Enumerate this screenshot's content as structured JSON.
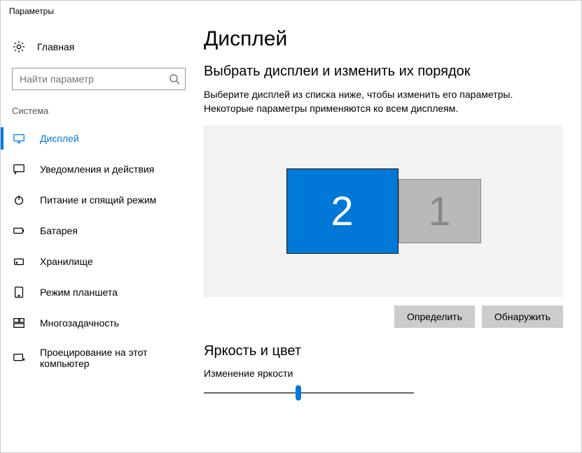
{
  "window": {
    "title": "Параметры"
  },
  "sidebar": {
    "home_label": "Главная",
    "search_placeholder": "Найти параметр",
    "section_label": "Система",
    "items": [
      {
        "id": "display",
        "label": "Дисплей",
        "active": true
      },
      {
        "id": "notifications",
        "label": "Уведомления и действия",
        "active": false
      },
      {
        "id": "power",
        "label": "Питание и спящий режим",
        "active": false
      },
      {
        "id": "battery",
        "label": "Батарея",
        "active": false
      },
      {
        "id": "storage",
        "label": "Хранилище",
        "active": false
      },
      {
        "id": "tablet",
        "label": "Режим планшета",
        "active": false
      },
      {
        "id": "multitask",
        "label": "Многозадачность",
        "active": false
      },
      {
        "id": "projecting",
        "label": "Проецирование на этот компьютер",
        "active": false
      }
    ]
  },
  "main": {
    "title": "Дисплей",
    "arrange": {
      "heading": "Выбрать дисплеи и изменить их порядок",
      "description": "Выберите дисплей из списка ниже, чтобы изменить его параметры. Некоторые параметры применяются ко всем дисплеям.",
      "monitors": [
        {
          "number": "2",
          "selected": true
        },
        {
          "number": "1",
          "selected": false
        }
      ],
      "identify_label": "Определить",
      "detect_label": "Обнаружить"
    },
    "brightness": {
      "heading": "Яркость и цвет",
      "slider_label": "Изменение яркости",
      "value": 45
    }
  },
  "colors": {
    "accent": "#0078d7",
    "panel": "#f2f2f2",
    "button": "#cccccc",
    "inactive_monitor": "#b9b9b9"
  }
}
